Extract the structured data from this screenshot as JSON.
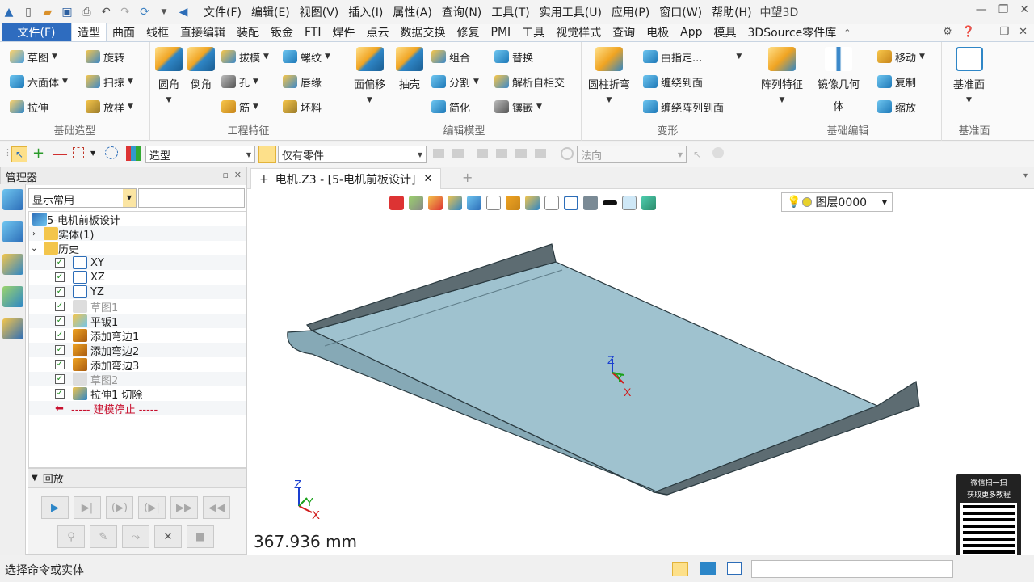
{
  "titlebar": {
    "menu": [
      "文件(F)",
      "编辑(E)",
      "视图(V)",
      "插入(I)",
      "属性(A)",
      "查询(N)",
      "工具(T)",
      "实用工具(U)",
      "应用(P)",
      "窗口(W)",
      "帮助(H)"
    ],
    "app_name": "中望3D"
  },
  "tabs": {
    "file": "文件(F)",
    "items": [
      "造型",
      "曲面",
      "线框",
      "直接编辑",
      "装配",
      "钣金",
      "FTI",
      "焊件",
      "点云",
      "数据交换",
      "修复",
      "PMI",
      "工具",
      "视觉样式",
      "查询",
      "电极",
      "App",
      "模具",
      "3DSource零件库"
    ],
    "active": "造型"
  },
  "ribbon": {
    "g1": {
      "label": "基础造型",
      "b1": "草图",
      "b2": "旋转",
      "b3": "六面体",
      "b4": "扫掠",
      "b5": "拉伸",
      "b6": "放样"
    },
    "g2": {
      "label": "工程特征",
      "b1": "圆角",
      "b2": "倒角",
      "b3": "拔模",
      "b4": "螺纹",
      "b5": "孔",
      "b6": "唇缘",
      "b7": "筋",
      "b8": "坯料"
    },
    "g3": {
      "label": "编辑模型",
      "b1": "面偏移",
      "b2": "抽壳",
      "b3": "组合",
      "b4": "替换",
      "b5": "分割",
      "b6": "解析自相交",
      "b7": "简化",
      "b8": "镶嵌"
    },
    "g4": {
      "label": "变形",
      "b1": "圆柱折弯",
      "b2": "由指定...",
      "b3": "缠绕到面",
      "b4": "缠绕阵列到面"
    },
    "g5": {
      "label": "基础编辑",
      "b1": "阵列特征",
      "b2a": "镜像几何",
      "b2b": "体",
      "b3": "移动",
      "b4": "复制",
      "b5": "缩放"
    },
    "g6": {
      "label": "基准面",
      "b1": "基准面"
    }
  },
  "toolbar2": {
    "mode": "造型",
    "filter": "仅有零件",
    "direction": "法向"
  },
  "manager": {
    "title": "管理器",
    "combo": "显示常用",
    "tree": [
      {
        "label": "5-电机前板设计",
        "check": false,
        "gray": false,
        "level": 0
      },
      {
        "label": "实体(1)",
        "check": false,
        "gray": false,
        "level": 1
      },
      {
        "label": "历史",
        "check": false,
        "gray": false,
        "level": 1
      },
      {
        "label": "XY",
        "check": true,
        "gray": false,
        "level": 2
      },
      {
        "label": "XZ",
        "check": true,
        "gray": false,
        "level": 2
      },
      {
        "label": "YZ",
        "check": true,
        "gray": false,
        "level": 2
      },
      {
        "label": "草图1",
        "check": true,
        "gray": true,
        "level": 2
      },
      {
        "label": "平钣1",
        "check": true,
        "gray": false,
        "level": 2
      },
      {
        "label": "添加弯边1",
        "check": true,
        "gray": false,
        "level": 2
      },
      {
        "label": "添加弯边2",
        "check": true,
        "gray": false,
        "level": 2
      },
      {
        "label": "添加弯边3",
        "check": true,
        "gray": false,
        "level": 2
      },
      {
        "label": "草图2",
        "check": true,
        "gray": true,
        "level": 2
      },
      {
        "label": "拉伸1 切除",
        "check": true,
        "gray": false,
        "level": 2
      }
    ],
    "stop": "----- 建模停止 -----",
    "playback": "回放"
  },
  "viewport": {
    "doc_tab": "电机.Z3 - [5-电机前板设计]",
    "layer": "图层0000",
    "scale": "367.936 mm",
    "axis_x": "X",
    "axis_y": "Y",
    "axis_z": "Z"
  },
  "status": {
    "text": "选择命令或实体"
  },
  "qr": {
    "line1": "微信扫一扫",
    "line2": "获取更多教程"
  }
}
